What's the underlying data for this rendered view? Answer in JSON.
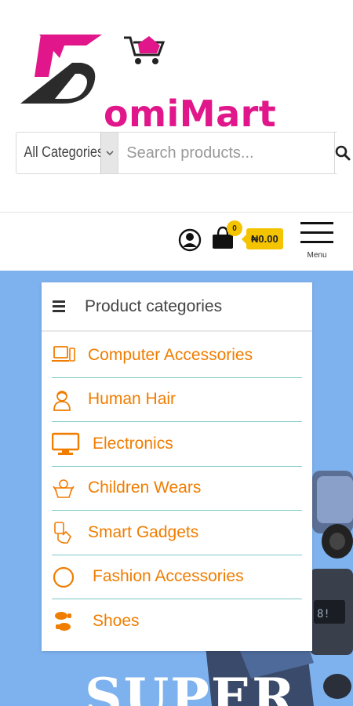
{
  "logo": {
    "text": "omiMart",
    "full_name": "DomiMart"
  },
  "search": {
    "category_label": "All Categories",
    "placeholder": "Search products..."
  },
  "header": {
    "cart_count": "0",
    "cart_total": "₦0.00",
    "menu_label": "Menu"
  },
  "categories_panel": {
    "title": "Product categories",
    "items": [
      {
        "label": "Computer Accessories",
        "icon": "laptop-icon"
      },
      {
        "label": "Human Hair",
        "icon": "person-hair-icon"
      },
      {
        "label": "Electronics",
        "icon": "monitor-icon"
      },
      {
        "label": "Children Wears",
        "icon": "baby-icon"
      },
      {
        "label": "Smart Gadgets",
        "icon": "hand-gadget-icon"
      },
      {
        "label": "Fashion Accessories",
        "icon": "ring-icon"
      },
      {
        "label": "Shoes",
        "icon": "footprints-icon"
      }
    ]
  },
  "hero": {
    "text": "SUPER"
  },
  "colors": {
    "brand_pink": "#e0168a",
    "accent_orange": "#f07d00",
    "badge_yellow": "#f5c400",
    "hero_blue": "#7eb2ee",
    "divider_teal": "#7ec8c8"
  }
}
